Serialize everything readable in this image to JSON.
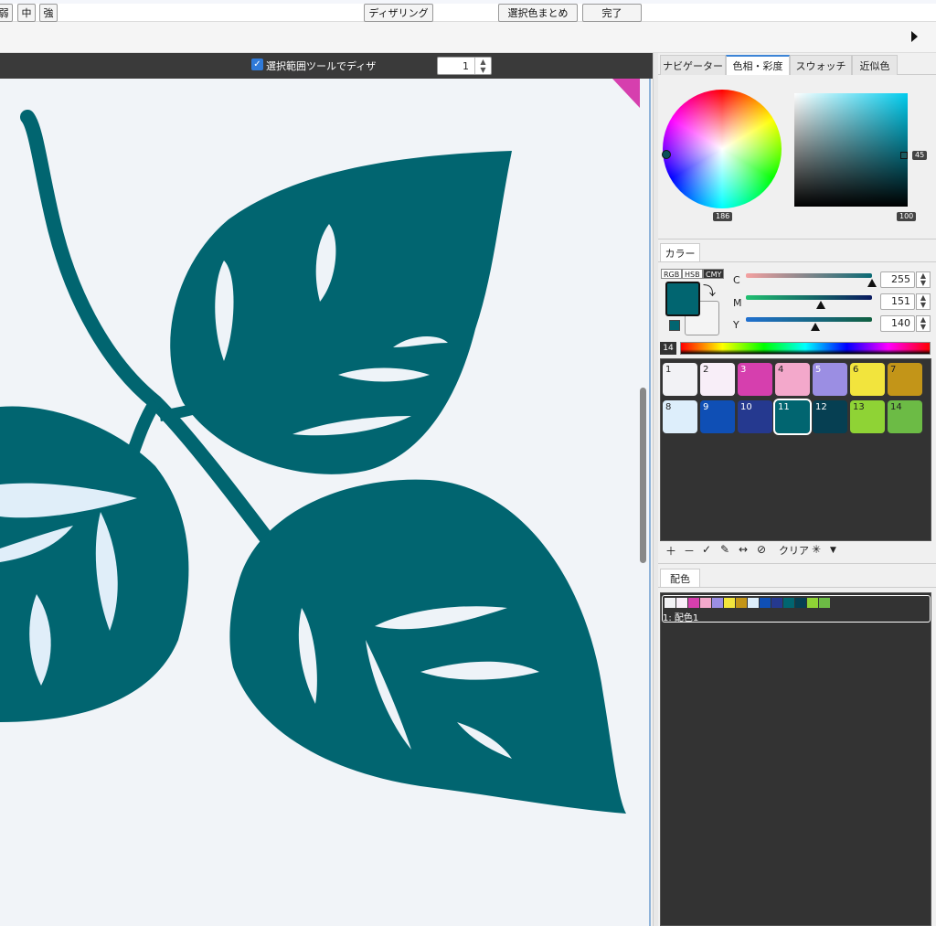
{
  "toolbar": {
    "left_buttons": [
      "弱",
      "中",
      "強"
    ],
    "checkbox_label": "選択範囲ツールでディザ",
    "dither_button": "ディザリング",
    "stepper_value": "1",
    "merge_button": "選択色まとめ",
    "done_button": "完了"
  },
  "tabs": [
    "ナビゲーター",
    "色相・彩度",
    "スウォッチ",
    "近似色"
  ],
  "wheel": {
    "hue_value": "186",
    "sat_value": "45",
    "bright_value": "100"
  },
  "color_section": {
    "tab": "カラー",
    "modes": [
      "RGB",
      "HSB",
      "CMY"
    ],
    "sliders": [
      {
        "label": "C",
        "value": "255",
        "pos": 1.0
      },
      {
        "label": "M",
        "value": "151",
        "pos": 0.59
      },
      {
        "label": "Y",
        "value": "140",
        "pos": 0.55
      }
    ],
    "spectrum_index": "14"
  },
  "swatches": [
    {
      "num": "1",
      "color": "#f2f2f5"
    },
    {
      "num": "2",
      "color": "#f8eef8"
    },
    {
      "num": "3",
      "color": "#d63fae"
    },
    {
      "num": "4",
      "color": "#f3a8cb"
    },
    {
      "num": "5",
      "color": "#9b8ee3"
    },
    {
      "num": "6",
      "color": "#f2e43d"
    },
    {
      "num": "7",
      "color": "#c39518"
    },
    {
      "num": "8",
      "color": "#ddeefb"
    },
    {
      "num": "9",
      "color": "#0f4fb5"
    },
    {
      "num": "10",
      "color": "#25398f"
    },
    {
      "num": "11",
      "color": "#016570"
    },
    {
      "num": "12",
      "color": "#063f52"
    },
    {
      "num": "13",
      "color": "#8fd335"
    },
    {
      "num": "14",
      "color": "#6cbb45"
    }
  ],
  "swatch_tools": {
    "clear_label": "クリア"
  },
  "haishoku": {
    "tab": "配色",
    "item_label": "1: 配色1"
  }
}
